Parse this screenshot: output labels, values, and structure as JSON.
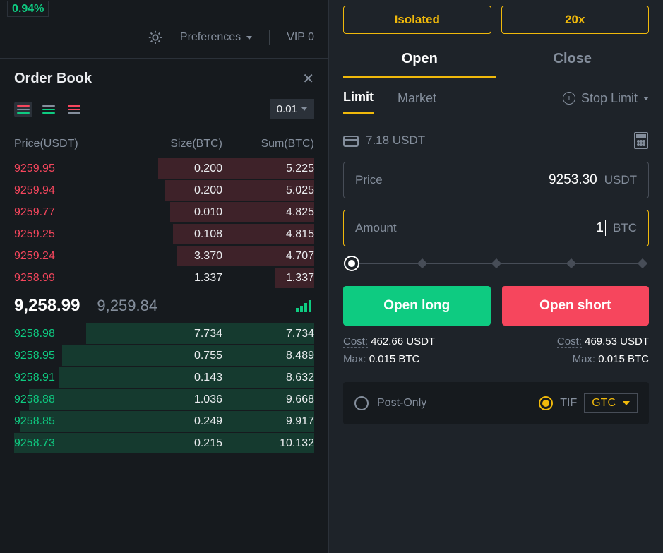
{
  "top": {
    "percent": "0.94%",
    "preferences_label": "Preferences",
    "vip_label": "VIP 0"
  },
  "orderbook": {
    "title": "Order Book",
    "tick": "0.01",
    "headers": {
      "price": "Price(USDT)",
      "size": "Size(BTC)",
      "sum": "Sum(BTC)"
    },
    "asks": [
      {
        "price": "9259.95",
        "size": "0.200",
        "sum": "5.225",
        "depth": 52
      },
      {
        "price": "9259.94",
        "size": "0.200",
        "sum": "5.025",
        "depth": 50
      },
      {
        "price": "9259.77",
        "size": "0.010",
        "sum": "4.825",
        "depth": 48
      },
      {
        "price": "9259.25",
        "size": "0.108",
        "sum": "4.815",
        "depth": 47
      },
      {
        "price": "9259.24",
        "size": "3.370",
        "sum": "4.707",
        "depth": 46
      },
      {
        "price": "9258.99",
        "size": "1.337",
        "sum": "1.337",
        "depth": 13
      }
    ],
    "mid_price": "9,258.99",
    "mid_mark": "9,259.84",
    "bids": [
      {
        "price": "9258.98",
        "size": "7.734",
        "sum": "7.734",
        "depth": 76
      },
      {
        "price": "9258.95",
        "size": "0.755",
        "sum": "8.489",
        "depth": 84
      },
      {
        "price": "9258.91",
        "size": "0.143",
        "sum": "8.632",
        "depth": 85
      },
      {
        "price": "9258.88",
        "size": "1.036",
        "sum": "9.668",
        "depth": 95
      },
      {
        "price": "9258.85",
        "size": "0.249",
        "sum": "9.917",
        "depth": 98
      },
      {
        "price": "9258.73",
        "size": "0.215",
        "sum": "10.132",
        "depth": 100
      }
    ]
  },
  "order": {
    "margin_mode": "Isolated",
    "leverage": "20x",
    "tabs": {
      "open": "Open",
      "close": "Close"
    },
    "types": {
      "limit": "Limit",
      "market": "Market",
      "stop": "Stop Limit"
    },
    "balance": "7.18 USDT",
    "price": {
      "label": "Price",
      "value": "9253.30",
      "unit": "USDT"
    },
    "amount": {
      "label": "Amount",
      "value": "1",
      "unit": "BTC"
    },
    "actions": {
      "long": "Open long",
      "short": "Open short"
    },
    "long_cost_label": "Cost:",
    "long_cost_value": "462.66 USDT",
    "long_max_label": "Max:",
    "long_max_value": "0.015 BTC",
    "short_cost_label": "Cost:",
    "short_cost_value": "469.53 USDT",
    "short_max_label": "Max:",
    "short_max_value": "0.015 BTC",
    "post_only_label": "Post-Only",
    "tif_label": "TIF",
    "tif_value": "GTC"
  }
}
